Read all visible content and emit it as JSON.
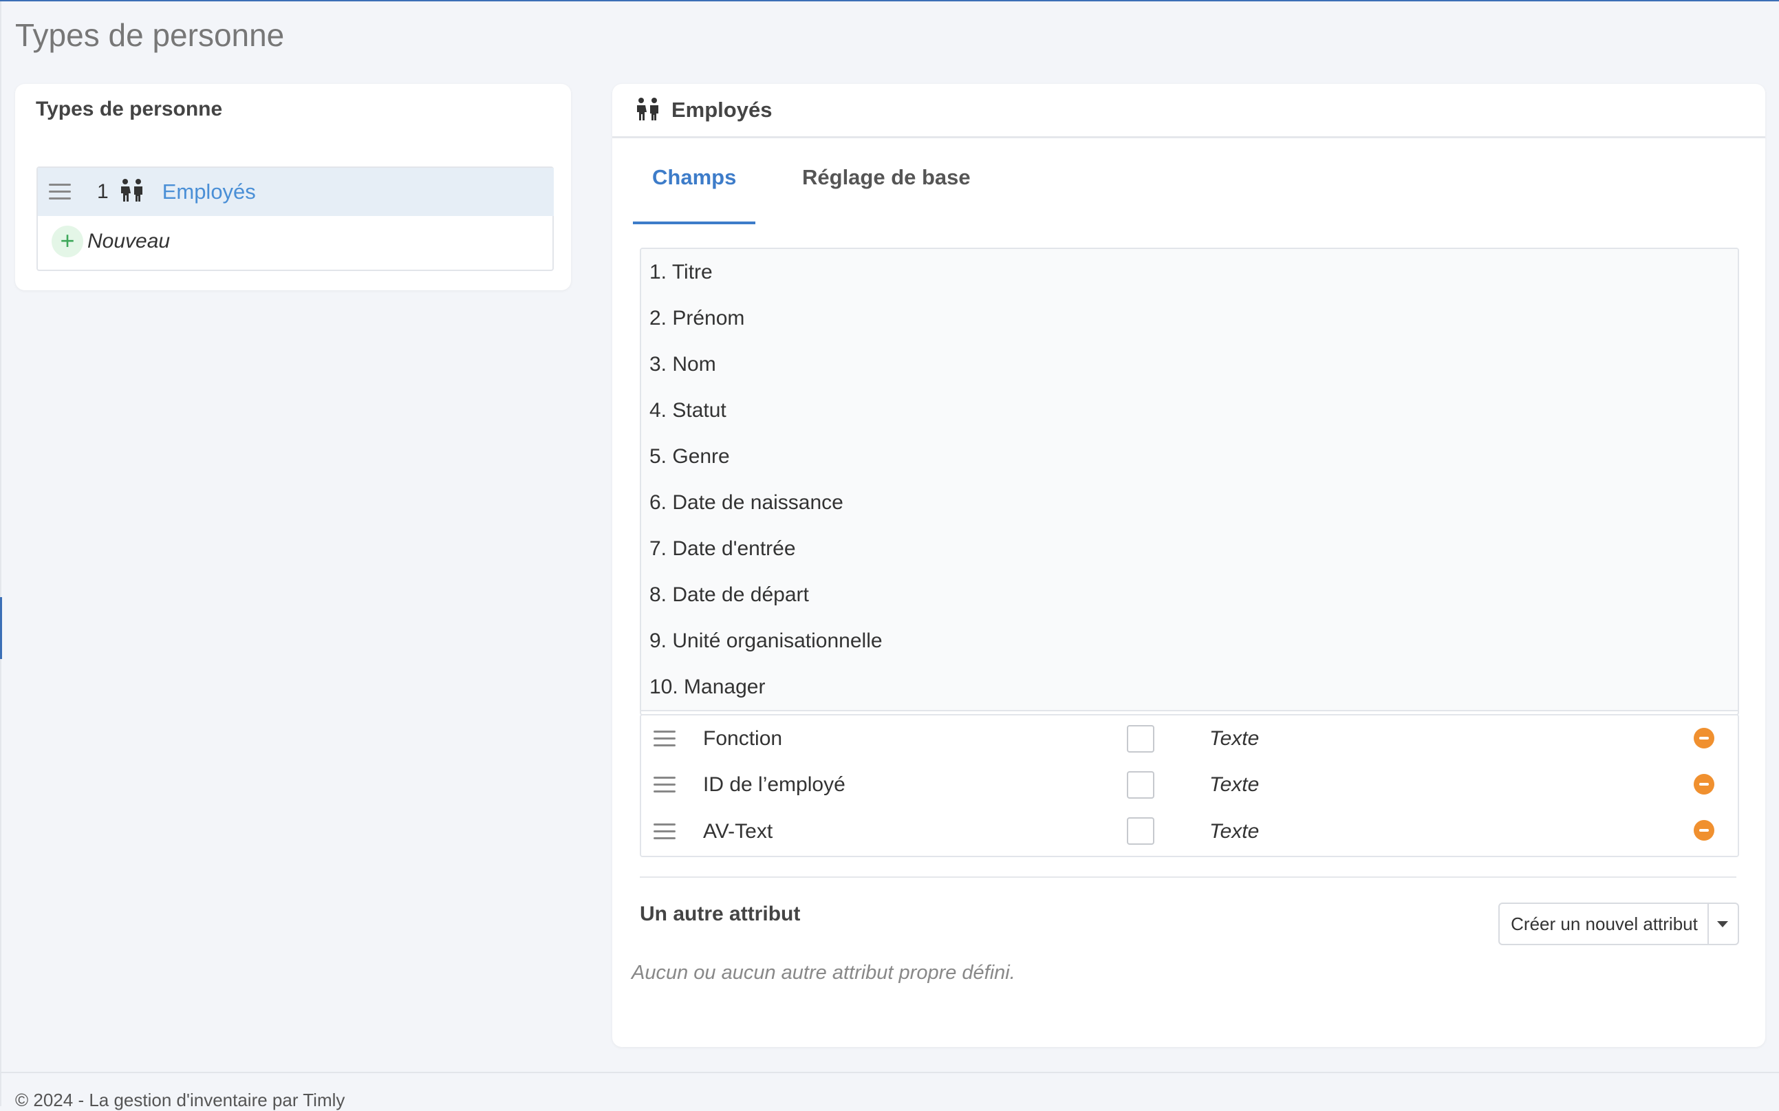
{
  "page": {
    "title": "Types de personne"
  },
  "left_panel": {
    "title": "Types de personne",
    "items": [
      {
        "number": "1",
        "icon": "people-icon",
        "label": "Employés"
      }
    ],
    "new_label": "Nouveau"
  },
  "right_panel": {
    "icon": "people-icon",
    "title": "Employés",
    "tabs": [
      {
        "label": "Champs",
        "active": true
      },
      {
        "label": "Réglage de base",
        "active": false
      }
    ],
    "fixed_fields": [
      "1. Titre",
      "2. Prénom",
      "3. Nom",
      "4. Statut",
      "5. Genre",
      "6. Date de naissance",
      "7. Date d'entrée",
      "8. Date de départ",
      "9. Unité organisationnelle",
      "10. Manager"
    ],
    "custom_fields": [
      {
        "name": "Fonction",
        "type": "Texte",
        "checked": false
      },
      {
        "name": "ID de l’employé",
        "type": "Texte",
        "checked": false
      },
      {
        "name": "AV-Text",
        "type": "Texte",
        "checked": false
      }
    ],
    "other_attribute_label": "Un autre attribut",
    "create_button_label": "Créer un nouvel attribut",
    "empty_note": "Aucun ou aucun autre attribut propre défini."
  },
  "footer": {
    "text": "© 2024 - La gestion d'inventaire par Timly"
  },
  "colors": {
    "accent": "#3d7cc9",
    "link": "#4a8fd6",
    "remove": "#f0902f",
    "add": "#3ea85a"
  }
}
